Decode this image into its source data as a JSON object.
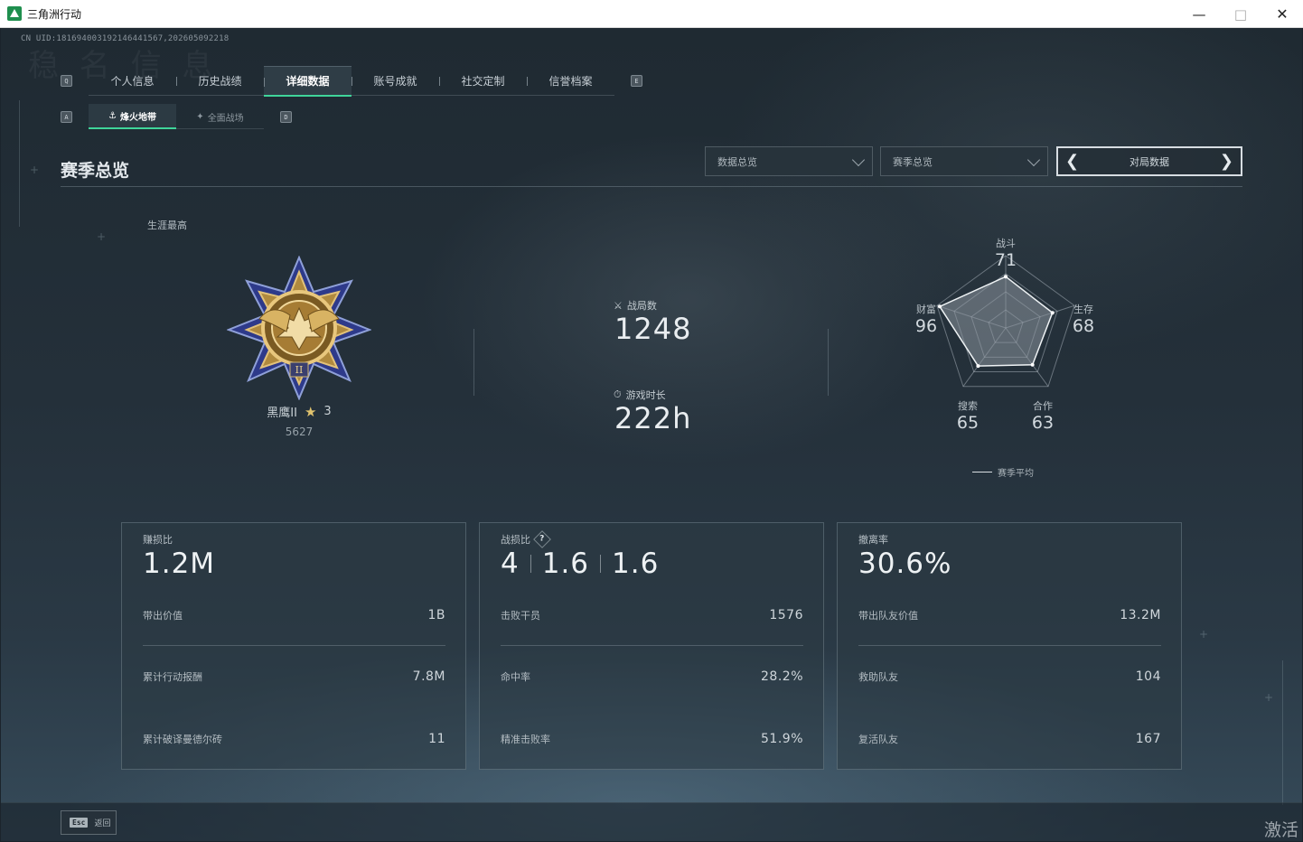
{
  "window": {
    "title": "三角洲行动"
  },
  "header": {
    "uid": "CN UID:181694003192146441567,202605092218",
    "ghost_text": "稳 名 信 息"
  },
  "main_tabs": {
    "prev_key": "Q",
    "next_key": "E",
    "items": [
      {
        "label": "个人信息"
      },
      {
        "label": "历史战绩"
      },
      {
        "label": "详细数据",
        "active": true
      },
      {
        "label": "账号成就"
      },
      {
        "label": "社交定制"
      },
      {
        "label": "信誉档案"
      }
    ]
  },
  "sub_tabs": {
    "prev_key": "A",
    "next_key": "D",
    "items": [
      {
        "label": "烽火地带",
        "icon": "hazard-zone-icon",
        "active": true
      },
      {
        "label": "全面战场",
        "icon": "battlefield-icon"
      }
    ]
  },
  "section": {
    "title": "赛季总览",
    "dropdown1": "数据总览",
    "dropdown2": "赛季总览",
    "pager_label": "对局数据"
  },
  "rank": {
    "lifetime_label": "生涯最高",
    "name": "黑鹰II",
    "stars": "3",
    "points": "5627"
  },
  "stats": {
    "matches_label": "战局数",
    "matches_value": "1248",
    "playtime_label": "游戏时长",
    "playtime_value": "222h"
  },
  "radar": {
    "legend": "赛季平均",
    "axes": [
      {
        "label": "战斗",
        "value": "71"
      },
      {
        "label": "生存",
        "value": "68"
      },
      {
        "label": "合作",
        "value": "63"
      },
      {
        "label": "搜索",
        "value": "65"
      },
      {
        "label": "财富",
        "value": "96"
      }
    ]
  },
  "cards": [
    {
      "label": "赚损比",
      "value": "1.2M",
      "rows": [
        {
          "label": "带出价值",
          "value": "1B"
        },
        {
          "label": "累计行动报酬",
          "value": "7.8M"
        },
        {
          "label": "累计破译曼德尔砖",
          "value": "11"
        }
      ]
    },
    {
      "label": "战损比",
      "help": "?",
      "values": [
        "4",
        "1.6",
        "1.6"
      ],
      "rows": [
        {
          "label": "击败干员",
          "value": "1576"
        },
        {
          "label": "命中率",
          "value": "28.2%"
        },
        {
          "label": "精准击败率",
          "value": "51.9%"
        }
      ]
    },
    {
      "label": "撤离率",
      "value": "30.6%",
      "rows": [
        {
          "label": "带出队友价值",
          "value": "13.2M"
        },
        {
          "label": "救助队友",
          "value": "104"
        },
        {
          "label": "复活队友",
          "value": "167"
        }
      ]
    }
  ],
  "footer": {
    "esc_key": "Esc",
    "back_label": "返回",
    "activate_text": "激活"
  },
  "colors": {
    "accent": "#3fd59a",
    "background": "#1f2a32",
    "text": "#cfd6dc"
  }
}
